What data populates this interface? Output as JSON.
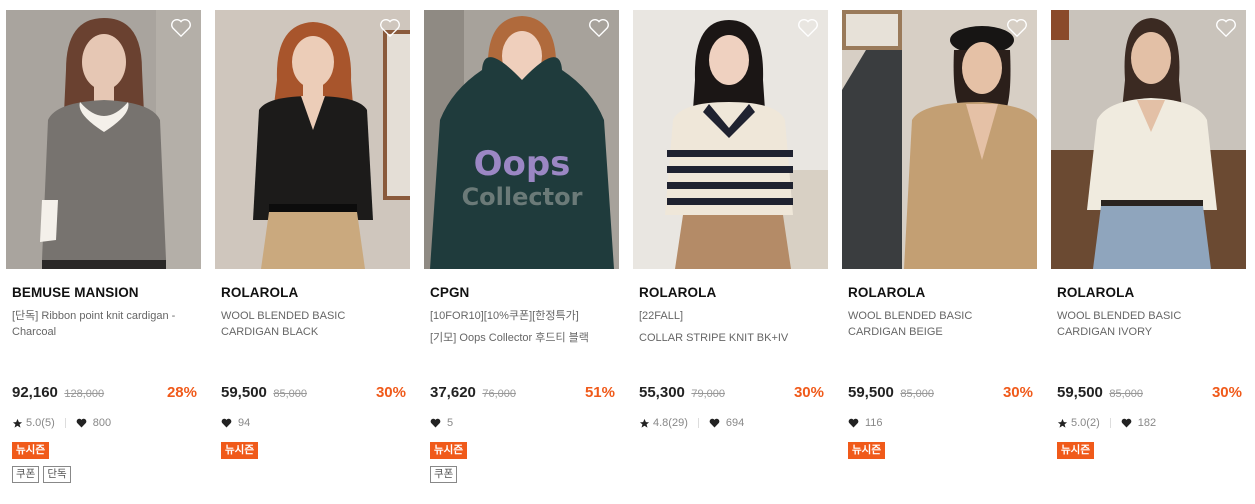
{
  "products": [
    {
      "brand": "BEMUSE MANSION",
      "name_lines": [
        "[단독] Ribbon point knit cardigan - Charcoal"
      ],
      "price": "92,160",
      "original_price": "128,000",
      "discount": "28%",
      "rating": "5.0(5)",
      "likes": "800",
      "badge": "뉴시즌",
      "tags": [
        "쿠폰",
        "단독"
      ],
      "photo_colors": {
        "bg": "#a9a49e",
        "garment": "#77736f",
        "hair": "#6a4130",
        "skin": "#e6c7b4"
      }
    },
    {
      "brand": "ROLAROLA",
      "name_lines": [
        "WOOL BLENDED BASIC CARDIGAN BLACK"
      ],
      "price": "59,500",
      "original_price": "85,000",
      "discount": "30%",
      "rating": "",
      "likes": "94",
      "badge": "뉴시즌",
      "tags": [],
      "photo_colors": {
        "bg": "#cfc6bd",
        "garment": "#1c1b1a",
        "hair": "#a8552c",
        "skin": "#eccdb8",
        "pants": "#caa97e"
      }
    },
    {
      "brand": "CPGN",
      "name_lines": [
        "[10FOR10][10%쿠폰][한정특가]",
        "[기모] Oops Collector 후드티 블랙"
      ],
      "price": "37,620",
      "original_price": "76,000",
      "discount": "51%",
      "rating": "",
      "likes": "5",
      "badge": "뉴시즌",
      "tags": [
        "쿠폰"
      ],
      "print_text_1": "Oops",
      "print_text_2": "Collector",
      "photo_colors": {
        "bg": "#a7a29b",
        "garment": "#1f3b3c",
        "hair": "#b06a3c",
        "skin": "#efcfbc"
      }
    },
    {
      "brand": "ROLAROLA",
      "name_lines": [
        "[22FALL]",
        "COLLAR STRIPE KNIT BK+IV"
      ],
      "price": "55,300",
      "original_price": "79,000",
      "discount": "30%",
      "rating": "4.8(29)",
      "likes": "694",
      "badge": "",
      "tags": [],
      "photo_colors": {
        "bg": "#e9e6e1",
        "garment": "#efe7d9",
        "hair": "#1b1615",
        "skin": "#efd1c0",
        "pants": "#b48b67"
      }
    },
    {
      "brand": "ROLAROLA",
      "name_lines": [
        "WOOL BLENDED BASIC CARDIGAN BEIGE"
      ],
      "price": "59,500",
      "original_price": "85,000",
      "discount": "30%",
      "rating": "",
      "likes": "116",
      "badge": "뉴시즌",
      "tags": [],
      "photo_colors": {
        "bg": "#d7cfc5",
        "garment": "#c39f73",
        "hair": "#2b1f1a",
        "skin": "#e5c1a6"
      }
    },
    {
      "brand": "ROLAROLA",
      "name_lines": [
        "WOOL BLENDED BASIC CARDIGAN IVORY"
      ],
      "price": "59,500",
      "original_price": "85,000",
      "discount": "30%",
      "rating": "5.0(2)",
      "likes": "182",
      "badge": "뉴시즌",
      "tags": [],
      "photo_colors": {
        "bg": "#c9c3bb",
        "garment": "#f0ebdf",
        "hair": "#3b2a22",
        "skin": "#e3c0a6",
        "pants": "#8fa5bd"
      }
    }
  ],
  "colors": {
    "discount": "#f05a1a",
    "badge": "#f05a1a",
    "heart_outline": "#ffffff"
  }
}
